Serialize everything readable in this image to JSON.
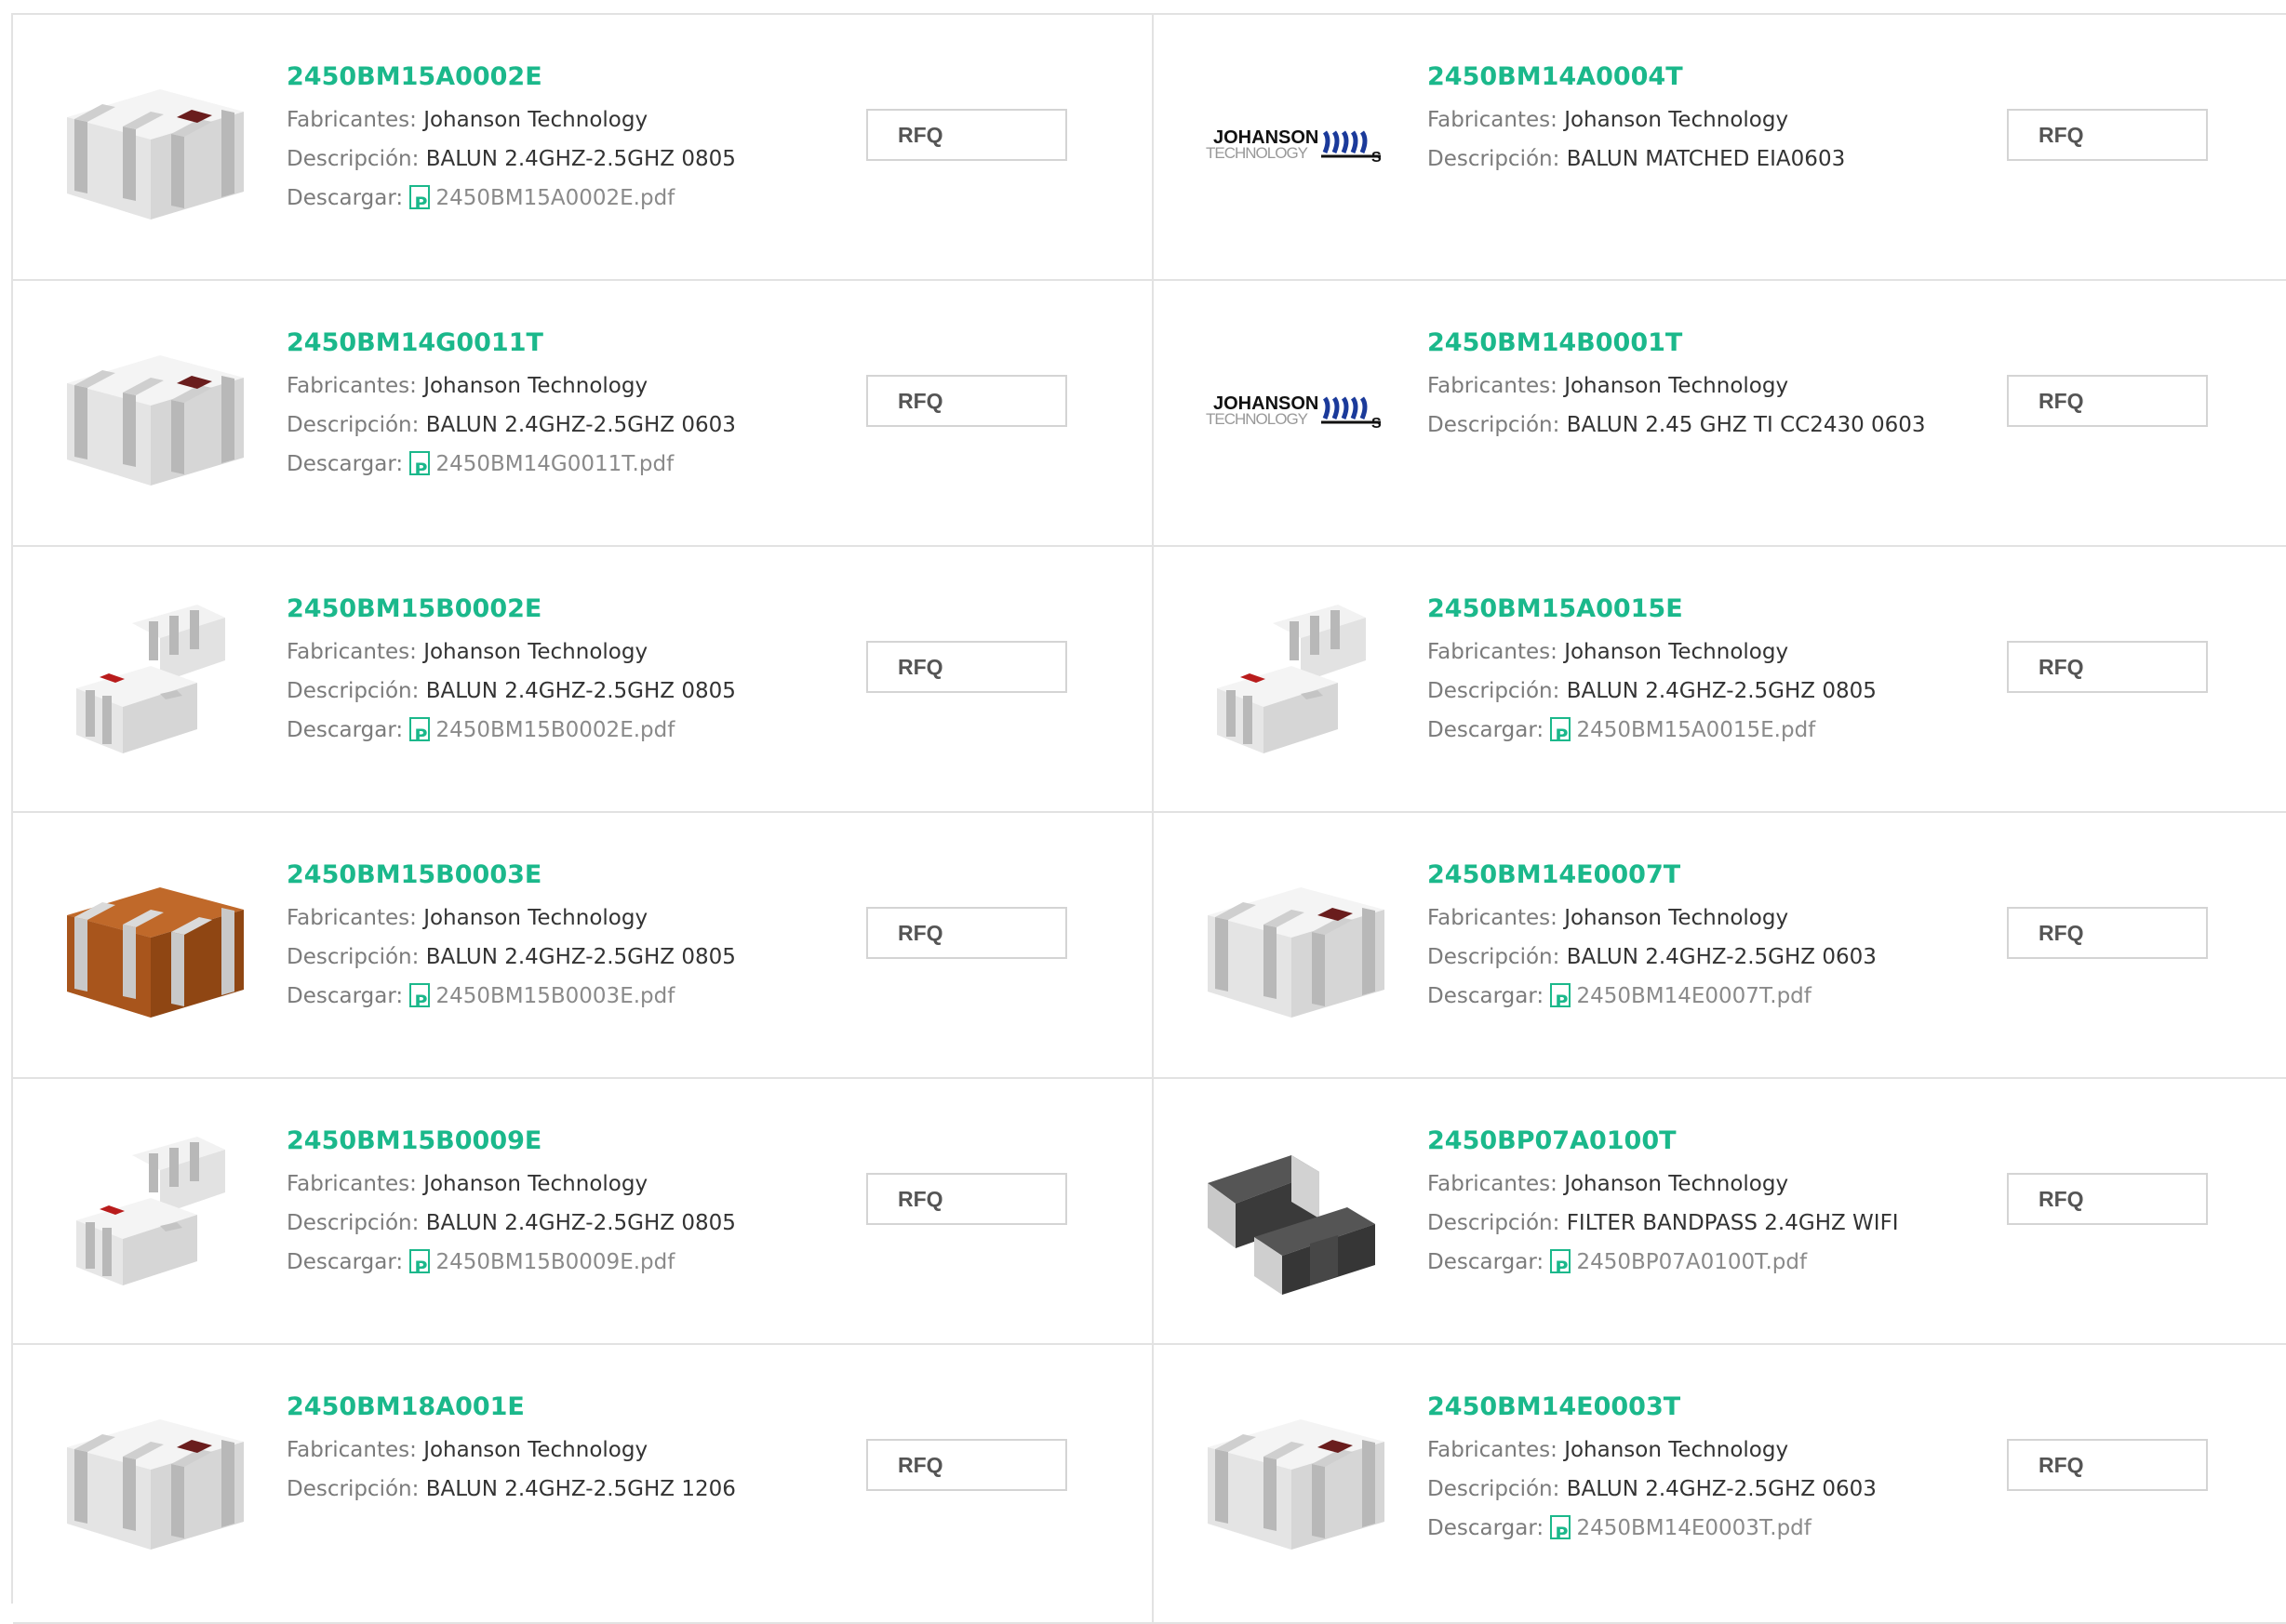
{
  "labels": {
    "manufacturer": "Fabricantes:",
    "description": "Descripción:",
    "download": "Descargar:",
    "rfq": "RFQ"
  },
  "colors": {
    "accent": "#1bb88b"
  },
  "products": [
    {
      "part": "2450BM15A0002E",
      "manufacturer": "Johanson Technology",
      "description": "BALUN 2.4GHZ-2.5GHZ 0805",
      "datasheet": "2450BM15A0002E.pdf",
      "image": "chip-white-4term"
    },
    {
      "part": "2450BM14A0004T",
      "manufacturer": "Johanson Technology",
      "description": "BALUN MATCHED EIA0603",
      "datasheet": null,
      "image": "johanson-logo"
    },
    {
      "part": "2450BM14G0011T",
      "manufacturer": "Johanson Technology",
      "description": "BALUN 2.4GHZ-2.5GHZ 0603",
      "datasheet": "2450BM14G0011T.pdf",
      "image": "chip-white-4term"
    },
    {
      "part": "2450BM14B0001T",
      "manufacturer": "Johanson Technology",
      "description": "BALUN 2.45 GHZ TI CC2430 0603",
      "datasheet": null,
      "image": "johanson-logo"
    },
    {
      "part": "2450BM15B0002E",
      "manufacturer": "Johanson Technology",
      "description": "BALUN 2.4GHZ-2.5GHZ 0805",
      "datasheet": "2450BM15B0002E.pdf",
      "image": "chip-pair-white"
    },
    {
      "part": "2450BM15A0015E",
      "manufacturer": "Johanson Technology",
      "description": "BALUN 2.4GHZ-2.5GHZ 0805",
      "datasheet": "2450BM15A0015E.pdf",
      "image": "chip-pair-white"
    },
    {
      "part": "2450BM15B0003E",
      "manufacturer": "Johanson Technology",
      "description": "BALUN 2.4GHZ-2.5GHZ 0805",
      "datasheet": "2450BM15B0003E.pdf",
      "image": "chip-brown-4term"
    },
    {
      "part": "2450BM14E0007T",
      "manufacturer": "Johanson Technology",
      "description": "BALUN 2.4GHZ-2.5GHZ 0603",
      "datasheet": "2450BM14E0007T.pdf",
      "image": "chip-white-4term"
    },
    {
      "part": "2450BM15B0009E",
      "manufacturer": "Johanson Technology",
      "description": "BALUN 2.4GHZ-2.5GHZ 0805",
      "datasheet": "2450BM15B0009E.pdf",
      "image": "chip-pair-white"
    },
    {
      "part": "2450BP07A0100T",
      "manufacturer": "Johanson Technology",
      "description": "FILTER BANDPASS 2.4GHZ WIFI",
      "datasheet": "2450BP07A0100T.pdf",
      "image": "chip-pair-dark"
    },
    {
      "part": "2450BM18A001E",
      "manufacturer": "Johanson Technology",
      "description": "BALUN 2.4GHZ-2.5GHZ 1206",
      "datasheet": null,
      "image": "chip-white-4term"
    },
    {
      "part": "2450BM14E0003T",
      "manufacturer": "Johanson Technology",
      "description": "BALUN 2.4GHZ-2.5GHZ 0603",
      "datasheet": "2450BM14E0003T.pdf",
      "image": "chip-white-4term"
    }
  ],
  "johanson_logo": {
    "line1": "JOHANSON",
    "line2": "TECHNOLOGY"
  }
}
